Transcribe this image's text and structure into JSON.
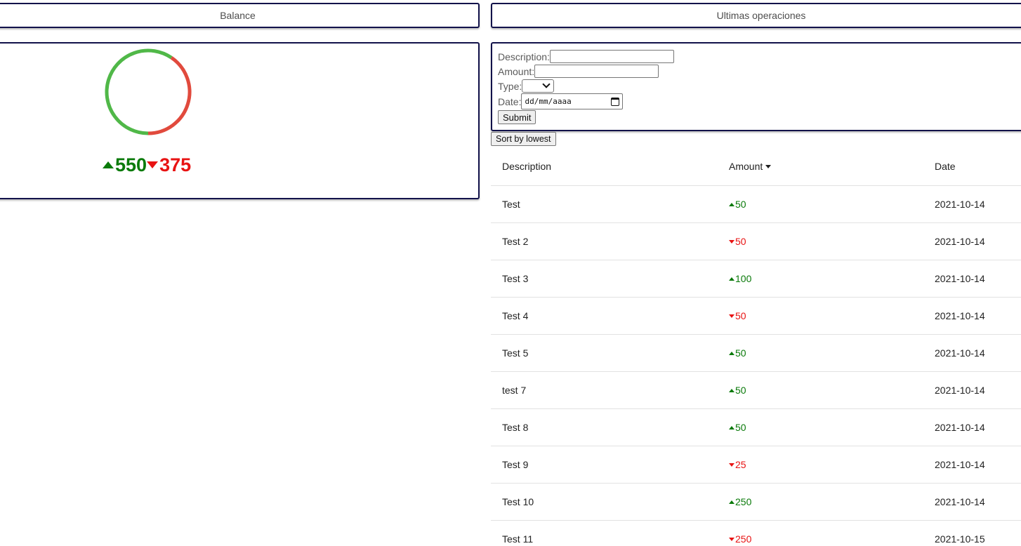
{
  "header": {
    "balance_title": "Balance",
    "operations_title": "Ultimas operaciones"
  },
  "balance": {
    "income_total": "550",
    "expense_total": "375",
    "income_share": 0.595,
    "colors": {
      "income": "#50b848",
      "expense": "#e14a3d"
    }
  },
  "form": {
    "description_label": "Description:",
    "description_value": "",
    "amount_label": "Amount:",
    "amount_value": "",
    "type_label": "Type:",
    "type_value": "",
    "date_label": "Date:",
    "date_placeholder": "dd/mm/aaaa",
    "submit_label": "Submit"
  },
  "sort_button_label": "Sort by lowest",
  "table": {
    "columns": [
      "Description",
      "Amount",
      "Date"
    ],
    "rows": [
      {
        "description": "Test",
        "amount": "50",
        "direction": "in",
        "date": "2021-10-14"
      },
      {
        "description": "Test 2",
        "amount": "50",
        "direction": "out",
        "date": "2021-10-14"
      },
      {
        "description": "Test 3",
        "amount": "100",
        "direction": "in",
        "date": "2021-10-14"
      },
      {
        "description": "Test 4",
        "amount": "50",
        "direction": "out",
        "date": "2021-10-14"
      },
      {
        "description": "Test 5",
        "amount": "50",
        "direction": "in",
        "date": "2021-10-14"
      },
      {
        "description": "test 7",
        "amount": "50",
        "direction": "in",
        "date": "2021-10-14"
      },
      {
        "description": "Test 8",
        "amount": "50",
        "direction": "in",
        "date": "2021-10-14"
      },
      {
        "description": "Test 9",
        "amount": "25",
        "direction": "out",
        "date": "2021-10-14"
      },
      {
        "description": "Test 10",
        "amount": "250",
        "direction": "in",
        "date": "2021-10-14"
      },
      {
        "description": "Test 11",
        "amount": "250",
        "direction": "out",
        "date": "2021-10-15"
      }
    ]
  }
}
